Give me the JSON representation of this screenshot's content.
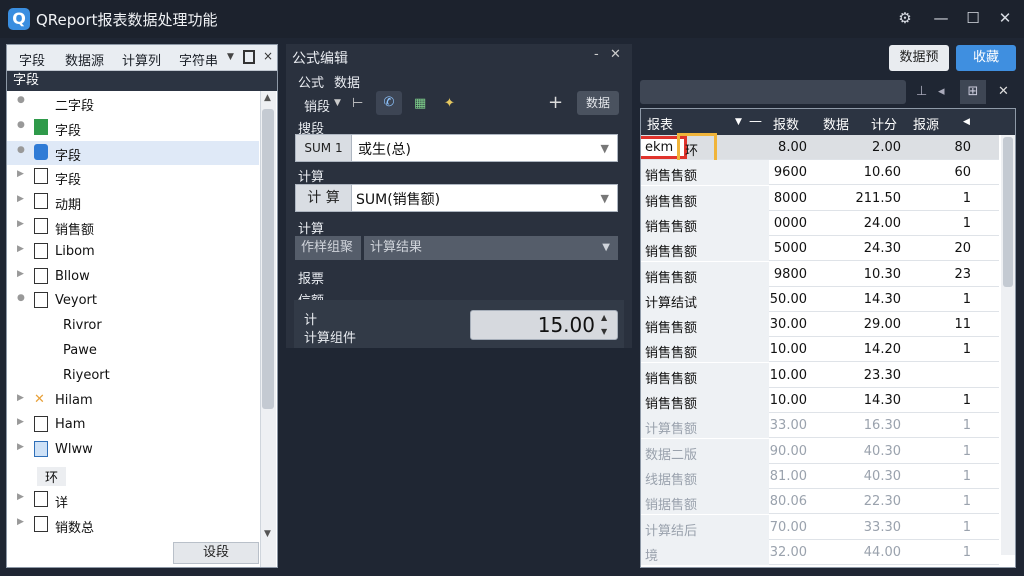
{
  "titlebar": {
    "logo": "Q",
    "title": "QReport报表数据处理功能",
    "buttons": [
      "⚙",
      "—",
      "☐",
      "✕"
    ]
  },
  "left_panel": {
    "toolbar_tabs": [
      "字段",
      "数据源",
      "计算列",
      "字符串"
    ],
    "header": "字段",
    "tree": [
      {
        "label": "二字段",
        "icon": "field-icon"
      },
      {
        "label": "字段",
        "icon": "chart-icon"
      },
      {
        "label": "字段",
        "icon": "formula-icon"
      },
      {
        "label": "字段",
        "icon": "file-icon"
      },
      {
        "label": "动期",
        "icon": "file-icon"
      },
      {
        "label": "销售额",
        "icon": "file-icon"
      },
      {
        "label": "Libom",
        "icon": "doc-icon"
      },
      {
        "label": "Bllow",
        "icon": "file-icon"
      },
      {
        "label": "Veyort",
        "icon": "folder-icon"
      },
      {
        "label": "Rivror",
        "icon": ""
      },
      {
        "label": "Pawe",
        "icon": ""
      },
      {
        "label": "Riyeort",
        "icon": ""
      },
      {
        "label": "Hilam",
        "icon": "cross-icon"
      },
      {
        "label": "Ham",
        "icon": "file-icon"
      },
      {
        "label": "Wlww",
        "icon": "image-icon"
      },
      {
        "label": "环",
        "icon": ""
      },
      {
        "label": "详",
        "icon": "file-icon"
      },
      {
        "label": "销数总",
        "icon": "file-icon"
      }
    ],
    "footer_button": "设段"
  },
  "mid_panel": {
    "title": "公式编辑",
    "tabs": [
      "公式",
      "数据"
    ],
    "toolbar_items": [
      "销段",
      "添加",
      "数据"
    ],
    "section_fields": "搜段",
    "field_prefix": "SUM 1",
    "field_value": "或生(总)",
    "section_calc": "计算",
    "calc_prefix": "计 算",
    "calc_value": "SUM(销售额)",
    "section_calc2": "计算",
    "calc2_left": "作样组聚",
    "calc2_right": "计算结果",
    "section_report": "报票",
    "section_amount": "信额",
    "amount_label1": "计",
    "amount_label2": "计算组件",
    "amount_value": "15.00"
  },
  "right_panel": {
    "buttons": [
      "数据预",
      "收藏"
    ],
    "grid_headers": [
      "报表",
      "—",
      "报数",
      "数据",
      "计分",
      "报源"
    ],
    "rows": [
      {
        "name": "ekm",
        "tag": "环",
        "v1": "8.00",
        "v2": "2.00",
        "v3": "80",
        "highlight": true
      },
      {
        "name": "销售售额",
        "v1": "9600",
        "v2": "10.60",
        "v3": "60"
      },
      {
        "name": "销售售额",
        "v1": "8000",
        "v2": "211.50",
        "v3": "1"
      },
      {
        "name": "销售售额",
        "v1": "0000",
        "v2": "24.00",
        "v3": "1"
      },
      {
        "name": "销售售额",
        "v1": "5000",
        "v2": "24.30",
        "v3": "20"
      },
      {
        "name": "销售售额",
        "v1": "9800",
        "v2": "10.30",
        "v3": "23"
      },
      {
        "name": "计算结试",
        "v1": "50.00",
        "v2": "14.30",
        "v3": "1"
      },
      {
        "name": "销售售额",
        "v1": "30.00",
        "v2": "29.00",
        "v3": "11"
      },
      {
        "name": "销售售额",
        "v1": "10.00",
        "v2": "14.20",
        "v3": "1"
      },
      {
        "name": "销售售额",
        "v1": "10.00",
        "v2": "23.30",
        "v3": ""
      },
      {
        "name": "销售售额",
        "v1": "10.00",
        "v2": "14.30",
        "v3": "1"
      },
      {
        "name": "计算售额",
        "v1": "33.00",
        "v2": "16.30",
        "v3": "1"
      },
      {
        "name": "数据二版",
        "v1": "90.00",
        "v2": "40.30",
        "v3": "1"
      },
      {
        "name": "线据售额",
        "v1": "81.00",
        "v2": "40.30",
        "v3": "1"
      },
      {
        "name": "销据售额",
        "v1": "80.06",
        "v2": "22.30",
        "v3": "1"
      },
      {
        "name": "计算结后",
        "v1": "70.00",
        "v2": "33.30",
        "v3": "1"
      },
      {
        "name": "境",
        "v1": "32.00",
        "v2": "44.00",
        "v3": "1"
      }
    ]
  }
}
